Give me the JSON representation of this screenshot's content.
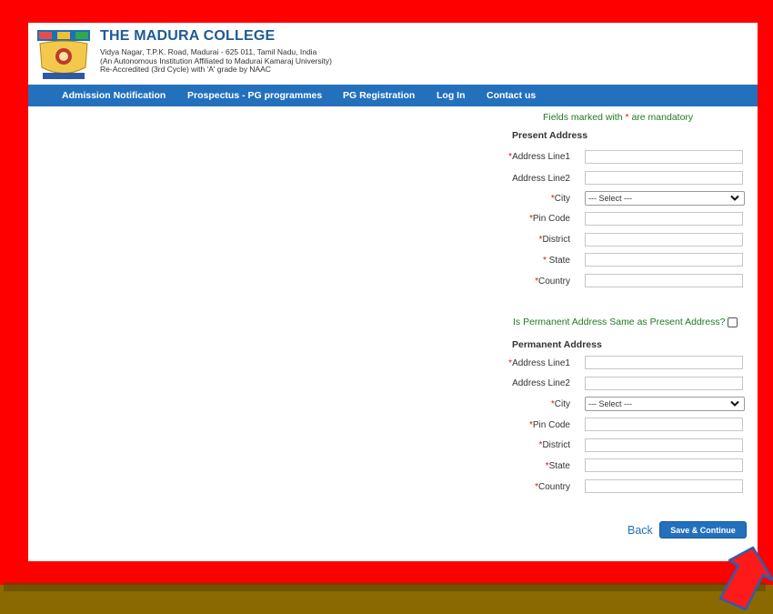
{
  "header": {
    "college_name": "THE MADURA COLLEGE",
    "address_line1": "Vidya Nagar, T.P.K. Road, Madurai - 625 011, Tamil Nadu, India",
    "address_line2": "(An Autonomous Institution Affiliated to Madurai Kamaraj University)",
    "address_line3": "Re-Accredited (3rd Cycle) with 'A' grade by NAAC"
  },
  "nav": {
    "items": [
      {
        "label": "Admission Notification"
      },
      {
        "label": "Prospectus - PG programmes"
      },
      {
        "label": "PG Registration"
      },
      {
        "label": "Log In"
      },
      {
        "label": "Contact us"
      }
    ]
  },
  "form": {
    "mandatory_note_pre": "Fields marked with ",
    "mandatory_star": "*",
    "mandatory_note_post": " are mandatory",
    "present": {
      "title": "Present Address",
      "address1_label": "Address Line1",
      "address2_label": "Address Line2",
      "city_label": "City",
      "city_value": "--- Select ---",
      "pincode_label": "Pin Code",
      "district_label": "District",
      "state_label": " State",
      "country_label": "Country"
    },
    "same_question": "Is Permanent Address Same as Present Address?",
    "permanent": {
      "title": "Permanent Address",
      "address1_label": "Address Line1",
      "address2_label": "Address Line2",
      "city_label": "City",
      "city_value": "--- Select ---",
      "pincode_label": "Pin Code",
      "district_label": "District",
      "state_label": "State",
      "country_label": "Country"
    },
    "back_label": "Back",
    "save_label": "Save & Continue"
  },
  "colors": {
    "frame": "#ff0000",
    "nav": "#2370bd",
    "accent_green": "#1f7a1f"
  }
}
